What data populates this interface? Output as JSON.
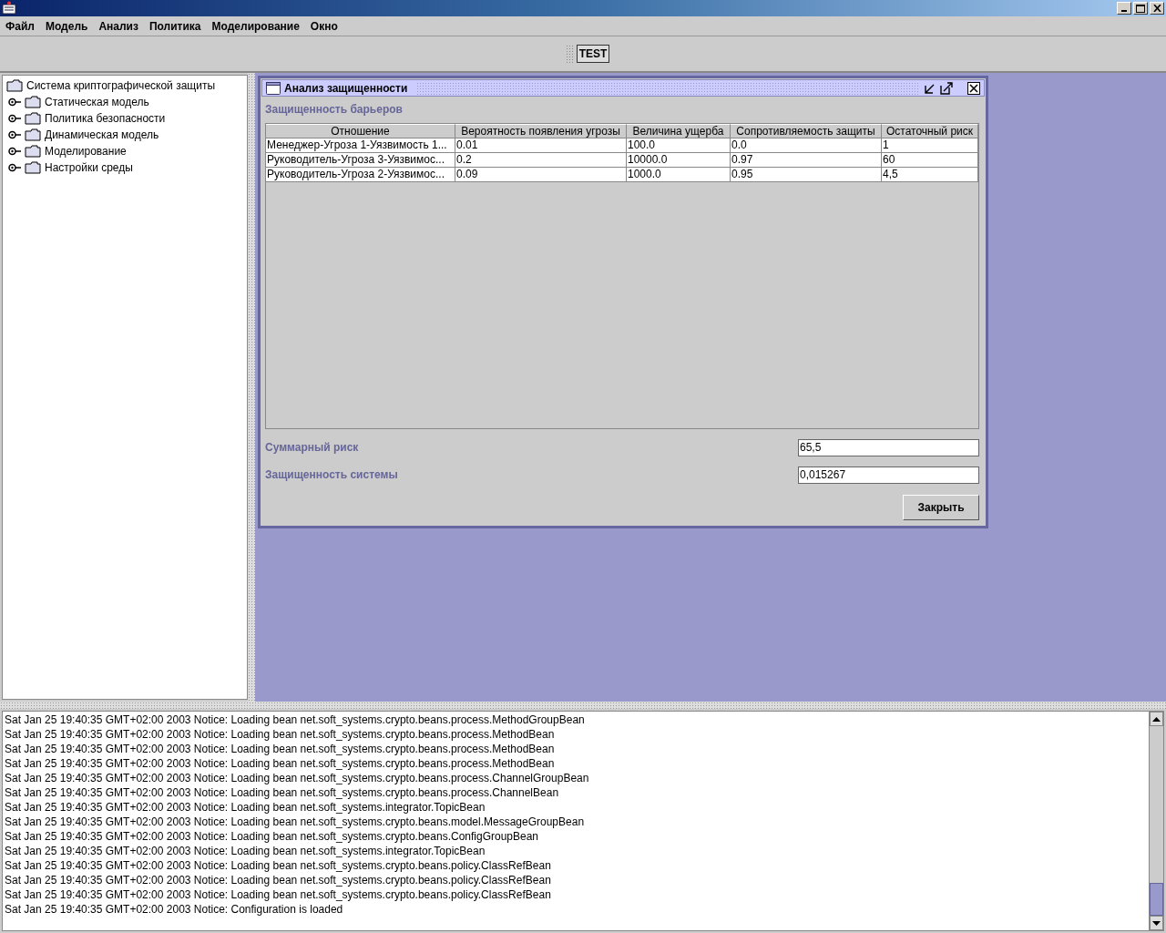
{
  "menu": [
    "Файл",
    "Модель",
    "Анализ",
    "Политика",
    "Моделирование",
    "Окно"
  ],
  "toolbar": {
    "button": "TEST"
  },
  "tree": {
    "root": "Система криптографической защиты",
    "items": [
      {
        "label": "Статическая модель",
        "expanded": false
      },
      {
        "label": "Политика безопасности",
        "expanded": false
      },
      {
        "label": "Динамическая модель",
        "expanded": false
      },
      {
        "label": "Моделирование",
        "expanded": false
      },
      {
        "label": "Настройки среды",
        "expanded": false
      }
    ]
  },
  "frame": {
    "title": "Анализ защищенности",
    "section": "Защищенность барьеров",
    "table": {
      "columns": [
        "Отношение",
        "Вероятность появления угрозы",
        "Величина ущерба",
        "Сопротивляемость защиты",
        "Остаточный риск"
      ],
      "rows": [
        [
          "Менеджер-Угроза 1-Уязвимость 1...",
          "0.01",
          "100.0",
          "0.0",
          "1"
        ],
        [
          "Руководитель-Угроза 3-Уязвимос...",
          "0.2",
          "10000.0",
          "0.97",
          "60"
        ],
        [
          "Руководитель-Угроза 2-Уязвимос...",
          "0.09",
          "1000.0",
          "0.95",
          "4,5"
        ]
      ]
    },
    "fields": [
      {
        "label": "Суммарный риск",
        "value": "65,5"
      },
      {
        "label": "Защищенность системы",
        "value": "0,015267"
      }
    ],
    "button": "Закрыть"
  },
  "log": [
    "Sat Jan 25 19:40:35 GMT+02:00 2003 Notice: Loading bean net.soft_systems.crypto.beans.process.MethodGroupBean",
    "Sat Jan 25 19:40:35 GMT+02:00 2003 Notice: Loading bean net.soft_systems.crypto.beans.process.MethodBean",
    "Sat Jan 25 19:40:35 GMT+02:00 2003 Notice: Loading bean net.soft_systems.crypto.beans.process.MethodBean",
    "Sat Jan 25 19:40:35 GMT+02:00 2003 Notice: Loading bean net.soft_systems.crypto.beans.process.MethodBean",
    "Sat Jan 25 19:40:35 GMT+02:00 2003 Notice: Loading bean net.soft_systems.crypto.beans.process.ChannelGroupBean",
    "Sat Jan 25 19:40:35 GMT+02:00 2003 Notice: Loading bean net.soft_systems.crypto.beans.process.ChannelBean",
    "Sat Jan 25 19:40:35 GMT+02:00 2003 Notice: Loading bean net.soft_systems.integrator.TopicBean",
    "Sat Jan 25 19:40:35 GMT+02:00 2003 Notice: Loading bean net.soft_systems.crypto.beans.model.MessageGroupBean",
    "Sat Jan 25 19:40:35 GMT+02:00 2003 Notice: Loading bean net.soft_systems.crypto.beans.ConfigGroupBean",
    "Sat Jan 25 19:40:35 GMT+02:00 2003 Notice: Loading bean net.soft_systems.integrator.TopicBean",
    "Sat Jan 25 19:40:35 GMT+02:00 2003 Notice: Loading bean net.soft_systems.crypto.beans.policy.ClassRefBean",
    "Sat Jan 25 19:40:35 GMT+02:00 2003 Notice: Loading bean net.soft_systems.crypto.beans.policy.ClassRefBean",
    "Sat Jan 25 19:40:35 GMT+02:00 2003 Notice: Loading bean net.soft_systems.crypto.beans.policy.ClassRefBean",
    "Sat Jan 25 19:40:35 GMT+02:00 2003 Notice: Configuration is loaded"
  ]
}
